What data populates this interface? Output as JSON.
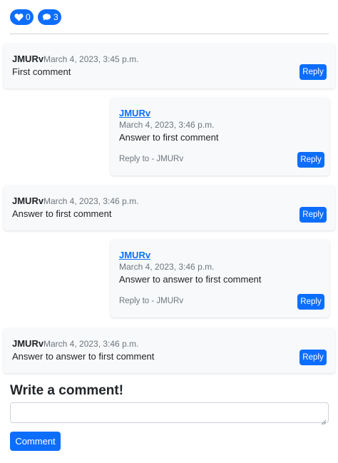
{
  "reactions": {
    "likes": "0",
    "comments": "3"
  },
  "comments": [
    {
      "author": "JMURv",
      "date": "March 4, 2023, 3:45 p.m.",
      "text": "First comment",
      "reply_label": "Reply"
    },
    {
      "author": "JMURv",
      "date": "March 4, 2023, 3:46 p.m.",
      "text": "Answer to first comment",
      "reply_to": "Reply to - JMURv",
      "reply_label": "Reply"
    },
    {
      "author": "JMURv",
      "date": "March 4, 2023, 3:46 p.m.",
      "text": "Answer to first comment",
      "reply_label": "Reply"
    },
    {
      "author": "JMURv",
      "date": "March 4, 2023, 3:46 p.m.",
      "text": "Answer to answer to first comment",
      "reply_to": "Reply to - JMURv",
      "reply_label": "Reply"
    },
    {
      "author": "JMURv",
      "date": "March 4, 2023, 3:46 p.m.",
      "text": "Answer to answer to first comment",
      "reply_label": "Reply"
    }
  ],
  "form": {
    "title": "Write a comment!",
    "input_value": "",
    "submit_label": "Comment"
  },
  "colors": {
    "primary": "#0d6efd",
    "card_bg": "#f8f9fa",
    "muted": "#6c757d"
  },
  "icons": {
    "like": "heart-icon",
    "comment": "speech-bubble-icon"
  }
}
